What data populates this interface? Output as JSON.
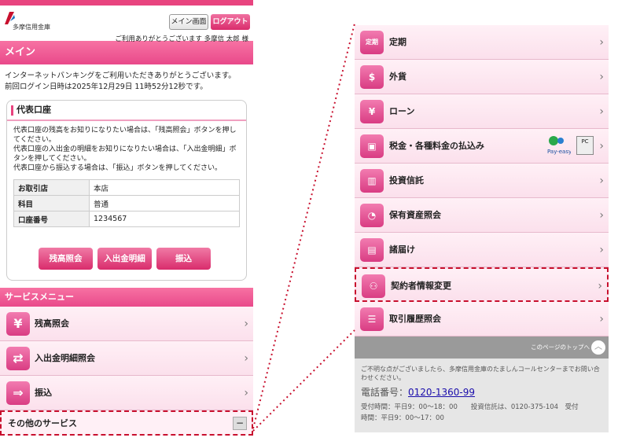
{
  "left": {
    "bank_name": "多摩信用金庫",
    "menu_button": "メイン画面",
    "logout_button": "ログアウト",
    "greeting": "ご利用ありがとうございます 多摩信 太郎 様",
    "title": "メイン",
    "intro_line1": "インターネットバンキングをご利用いただきありがとうございます。",
    "intro_line2": "前回ログイン日時は2025年12月29日 11時52分12秒です。",
    "card": {
      "title": "代表口座",
      "desc1": "代表口座の残高をお知りになりたい場合は、「残高照会」ボタンを押してください。",
      "desc2": "代表口座の入出金の明細をお知りになりたい場合は、「入出金明細」ボタンを押してください。",
      "desc3": "代表口座から振込する場合は、「振込」ボタンを押してください。",
      "rows": [
        {
          "k": "お取引店",
          "v": "本店"
        },
        {
          "k": "科目",
          "v": "普通"
        },
        {
          "k": "口座番号",
          "v": "1234567"
        }
      ],
      "buttons": [
        "残高照会",
        "入出金明細",
        "振込"
      ]
    },
    "service_header": "サービスメニュー",
    "services": [
      "残高照会",
      "入出金明細照会",
      "振込"
    ],
    "other": "その他のサービス"
  },
  "right": {
    "items": [
      "定期",
      "外貨",
      "ローン",
      "税金・各種料金の払込み",
      "投資信託",
      "保有資産照会",
      "諸届け",
      "契約者情報変更",
      "取引履歴照会"
    ],
    "teiki_icon": "定期",
    "pc_label": "PC",
    "to_top": "このページのトップへ",
    "note": "ご不明な点がございましたら、多摩信用金庫のたましんコールセンターまでお問い合わせください。",
    "tel_label": "電話番号：",
    "tel": "0120-1360-99",
    "hours1": "受付時間：平日9：00〜18：00　　投資信託は、0120-375-104　受付",
    "hours2": "時間：平日9：00〜17：00"
  },
  "colors": {
    "accent": "#e8447f",
    "highlight": "#c8102e"
  }
}
